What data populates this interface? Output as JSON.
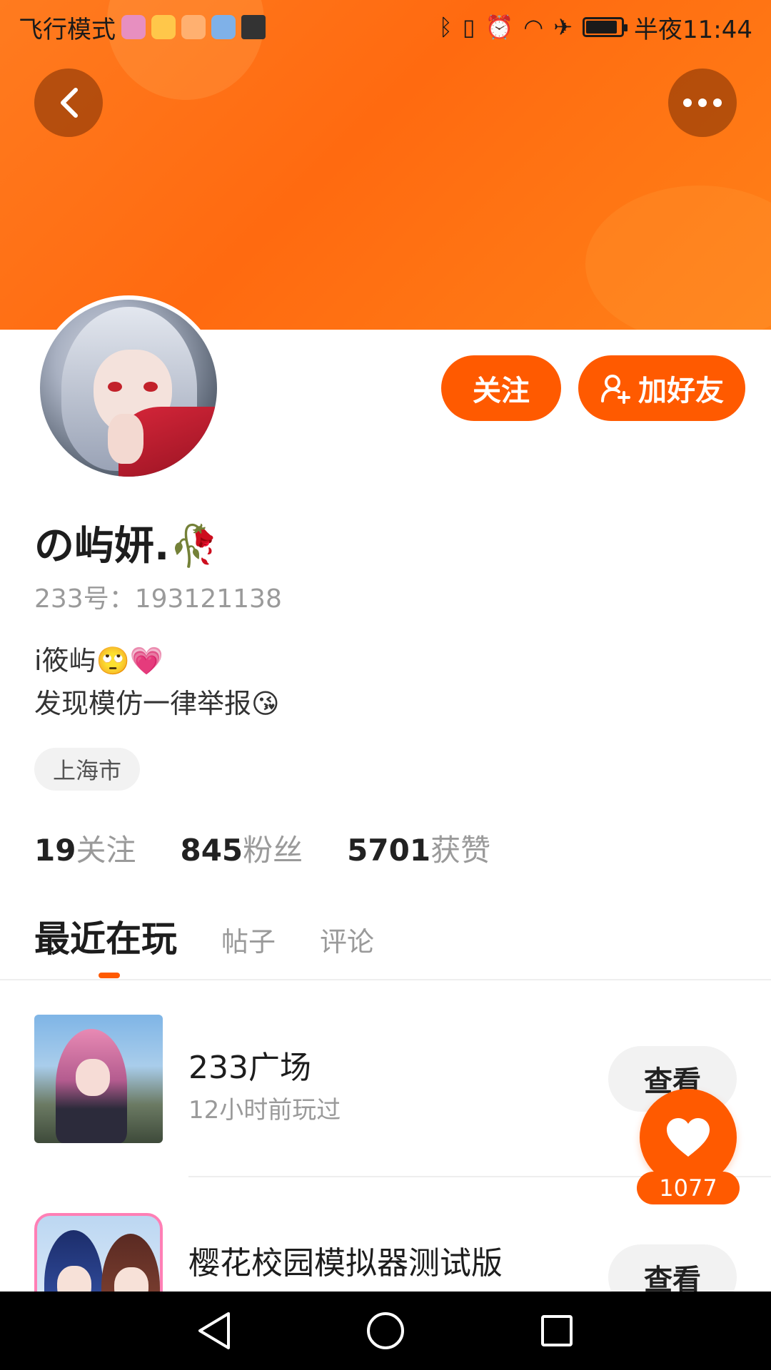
{
  "status_bar": {
    "left_text": "飞行模式",
    "time": "半夜11:44",
    "app_icons": [
      "music-app-icon",
      "files-app-icon",
      "video-app-icon",
      "browser-app-icon",
      "storage-app-icon"
    ],
    "battery_level": 0.9
  },
  "header": {
    "back_icon": "chevron-left-icon",
    "more_icon": "more-dots-icon"
  },
  "actions": {
    "follow_label": "关注",
    "add_friend_label": "加好友"
  },
  "profile": {
    "username": "⁣⁣⁣⁣の屿妍.🥀",
    "uid": "233号：193121138",
    "bio": "i筱屿🙄💗\n发现模仿一律举报😘",
    "location": "上海市"
  },
  "stats": [
    {
      "num": "19",
      "label": "关注"
    },
    {
      "num": "845",
      "label": "粉丝"
    },
    {
      "num": "5701",
      "label": "获赞"
    }
  ],
  "tabs": [
    "最近在玩",
    "帖子",
    "评论"
  ],
  "games": [
    {
      "title": "233广场",
      "subtitle": "12小时前玩过",
      "button": "查看"
    },
    {
      "title": "樱花校园模拟器测试版",
      "subtitle": "",
      "button": "查看"
    }
  ],
  "like": {
    "count": "1077"
  },
  "colors": {
    "accent": "#ff5a00",
    "banner": "#ff7017"
  }
}
